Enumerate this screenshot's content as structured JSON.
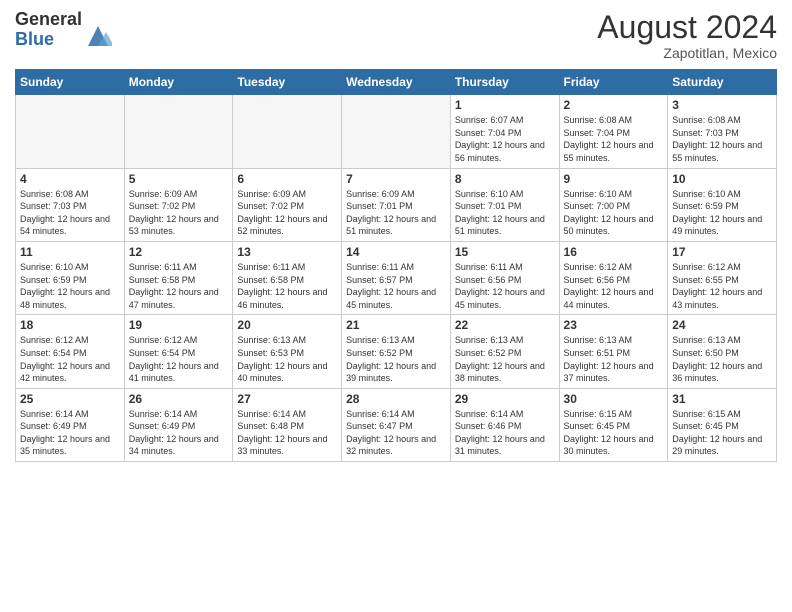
{
  "header": {
    "logo_general": "General",
    "logo_blue": "Blue",
    "month_year": "August 2024",
    "location": "Zapotitlan, Mexico"
  },
  "days_of_week": [
    "Sunday",
    "Monday",
    "Tuesday",
    "Wednesday",
    "Thursday",
    "Friday",
    "Saturday"
  ],
  "weeks": [
    [
      {
        "day": "",
        "empty": true
      },
      {
        "day": "",
        "empty": true
      },
      {
        "day": "",
        "empty": true
      },
      {
        "day": "",
        "empty": true
      },
      {
        "day": "1",
        "sunrise": "6:07 AM",
        "sunset": "7:04 PM",
        "daylight": "12 hours and 56 minutes."
      },
      {
        "day": "2",
        "sunrise": "6:08 AM",
        "sunset": "7:04 PM",
        "daylight": "12 hours and 55 minutes."
      },
      {
        "day": "3",
        "sunrise": "6:08 AM",
        "sunset": "7:03 PM",
        "daylight": "12 hours and 55 minutes."
      }
    ],
    [
      {
        "day": "4",
        "sunrise": "6:08 AM",
        "sunset": "7:03 PM",
        "daylight": "12 hours and 54 minutes."
      },
      {
        "day": "5",
        "sunrise": "6:09 AM",
        "sunset": "7:02 PM",
        "daylight": "12 hours and 53 minutes."
      },
      {
        "day": "6",
        "sunrise": "6:09 AM",
        "sunset": "7:02 PM",
        "daylight": "12 hours and 52 minutes."
      },
      {
        "day": "7",
        "sunrise": "6:09 AM",
        "sunset": "7:01 PM",
        "daylight": "12 hours and 51 minutes."
      },
      {
        "day": "8",
        "sunrise": "6:10 AM",
        "sunset": "7:01 PM",
        "daylight": "12 hours and 51 minutes."
      },
      {
        "day": "9",
        "sunrise": "6:10 AM",
        "sunset": "7:00 PM",
        "daylight": "12 hours and 50 minutes."
      },
      {
        "day": "10",
        "sunrise": "6:10 AM",
        "sunset": "6:59 PM",
        "daylight": "12 hours and 49 minutes."
      }
    ],
    [
      {
        "day": "11",
        "sunrise": "6:10 AM",
        "sunset": "6:59 PM",
        "daylight": "12 hours and 48 minutes."
      },
      {
        "day": "12",
        "sunrise": "6:11 AM",
        "sunset": "6:58 PM",
        "daylight": "12 hours and 47 minutes."
      },
      {
        "day": "13",
        "sunrise": "6:11 AM",
        "sunset": "6:58 PM",
        "daylight": "12 hours and 46 minutes."
      },
      {
        "day": "14",
        "sunrise": "6:11 AM",
        "sunset": "6:57 PM",
        "daylight": "12 hours and 45 minutes."
      },
      {
        "day": "15",
        "sunrise": "6:11 AM",
        "sunset": "6:56 PM",
        "daylight": "12 hours and 45 minutes."
      },
      {
        "day": "16",
        "sunrise": "6:12 AM",
        "sunset": "6:56 PM",
        "daylight": "12 hours and 44 minutes."
      },
      {
        "day": "17",
        "sunrise": "6:12 AM",
        "sunset": "6:55 PM",
        "daylight": "12 hours and 43 minutes."
      }
    ],
    [
      {
        "day": "18",
        "sunrise": "6:12 AM",
        "sunset": "6:54 PM",
        "daylight": "12 hours and 42 minutes."
      },
      {
        "day": "19",
        "sunrise": "6:12 AM",
        "sunset": "6:54 PM",
        "daylight": "12 hours and 41 minutes."
      },
      {
        "day": "20",
        "sunrise": "6:13 AM",
        "sunset": "6:53 PM",
        "daylight": "12 hours and 40 minutes."
      },
      {
        "day": "21",
        "sunrise": "6:13 AM",
        "sunset": "6:52 PM",
        "daylight": "12 hours and 39 minutes."
      },
      {
        "day": "22",
        "sunrise": "6:13 AM",
        "sunset": "6:52 PM",
        "daylight": "12 hours and 38 minutes."
      },
      {
        "day": "23",
        "sunrise": "6:13 AM",
        "sunset": "6:51 PM",
        "daylight": "12 hours and 37 minutes."
      },
      {
        "day": "24",
        "sunrise": "6:13 AM",
        "sunset": "6:50 PM",
        "daylight": "12 hours and 36 minutes."
      }
    ],
    [
      {
        "day": "25",
        "sunrise": "6:14 AM",
        "sunset": "6:49 PM",
        "daylight": "12 hours and 35 minutes."
      },
      {
        "day": "26",
        "sunrise": "6:14 AM",
        "sunset": "6:49 PM",
        "daylight": "12 hours and 34 minutes."
      },
      {
        "day": "27",
        "sunrise": "6:14 AM",
        "sunset": "6:48 PM",
        "daylight": "12 hours and 33 minutes."
      },
      {
        "day": "28",
        "sunrise": "6:14 AM",
        "sunset": "6:47 PM",
        "daylight": "12 hours and 32 minutes."
      },
      {
        "day": "29",
        "sunrise": "6:14 AM",
        "sunset": "6:46 PM",
        "daylight": "12 hours and 31 minutes."
      },
      {
        "day": "30",
        "sunrise": "6:15 AM",
        "sunset": "6:45 PM",
        "daylight": "12 hours and 30 minutes."
      },
      {
        "day": "31",
        "sunrise": "6:15 AM",
        "sunset": "6:45 PM",
        "daylight": "12 hours and 29 minutes."
      }
    ]
  ],
  "labels": {
    "sunrise": "Sunrise:",
    "sunset": "Sunset:",
    "daylight": "Daylight:"
  }
}
